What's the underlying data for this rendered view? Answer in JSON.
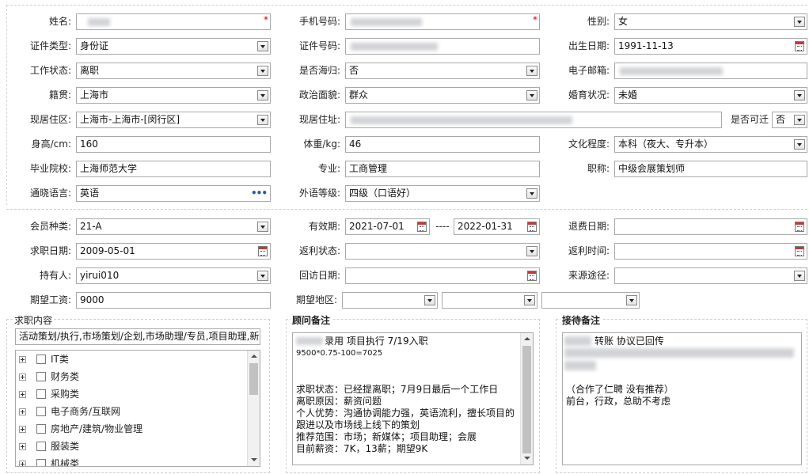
{
  "basic": {
    "name_label": "姓名:",
    "mobile_label": "手机号码:",
    "gender_label": "性别:",
    "gender_value": "女",
    "idtype_label": "证件类型:",
    "idtype_value": "身份证",
    "idno_label": "证件号码:",
    "birth_label": "出生日期:",
    "birth_value": "1991-11-13",
    "workstatus_label": "工作状态:",
    "workstatus_value": "离职",
    "returnee_label": "是否海归:",
    "returnee_value": "否",
    "email_label": "电子邮箱:",
    "native_label": "籍贯:",
    "native_value": "上海市",
    "political_label": "政治面貌:",
    "political_value": "群众",
    "marital_label": "婚育状况:",
    "marital_value": "未婚",
    "residence_label": "现居住区:",
    "residence_value": "上海市-上海市-[闵行区]",
    "address_label": "现居住址:",
    "relocate_label": "是否可迁",
    "relocate_value": "否",
    "height_label": "身高/cm:",
    "height_value": "160",
    "weight_label": "体重/kg:",
    "weight_value": "46",
    "education_label": "文化程度:",
    "education_value": "本科（夜大、专升本）",
    "school_label": "毕业院校:",
    "school_value": "上海师范大学",
    "major_label": "专业:",
    "major_value": "工商管理",
    "title_label": "职称:",
    "title_value": "中级会展策划师",
    "language_label": "通晓语言:",
    "language_value": "英语",
    "foreign_level_label": "外语等级:",
    "foreign_level_value": "四级（口语好）",
    "required_mark": "*",
    "more_dots": "•••"
  },
  "member": {
    "type_label": "会员种类:",
    "type_value": "21-A",
    "valid_label": "有效期:",
    "valid_from": "2021-07-01",
    "valid_sep": "----",
    "valid_to": "2022-01-31",
    "refund_date_label": "退费日期:",
    "jobdate_label": "求职日期:",
    "jobdate_value": "2009-05-01",
    "rebate_status_label": "返利状态:",
    "rebate_time_label": "返利时间:",
    "holder_label": "持有人:",
    "holder_value": "yirui010",
    "revisit_label": "回访日期:",
    "source_label": "来源途径:",
    "salary_label": "期望工资:",
    "salary_value": "9000",
    "area_label": "期望地区:"
  },
  "job": {
    "title": "求职内容",
    "summary": "活动策划/执行,市场策划/企划,市场助理/专员,项目助理,新媒",
    "categories": [
      "IT类",
      "财务类",
      "采购类",
      "电子商务/互联网",
      "房地产/建筑/物业管理",
      "服装类",
      "机械类"
    ]
  },
  "advisor": {
    "title": "顾问备注",
    "line1_suffix": "录用 项目执行 7/19入职",
    "line2": "9500*0.75-100=7025",
    "lines": [
      "求职状态：已经提离职；7月9日最后一个工作日",
      "离职原因：薪资问题",
      "个人优势：沟通协调能力强，英语流利，擅长项目的",
      "跟进以及市场线上线下的策划",
      "推荐范围：市场；新媒体；项目助理；会展",
      "目前薪资：7K，13薪；期望9K"
    ]
  },
  "reception": {
    "title": "接待备注",
    "line1_suffix": "转账 协议已回传",
    "line3": "（合作了仁聘 没有推荐）",
    "line4": "前台，行政，总助不考虑"
  }
}
